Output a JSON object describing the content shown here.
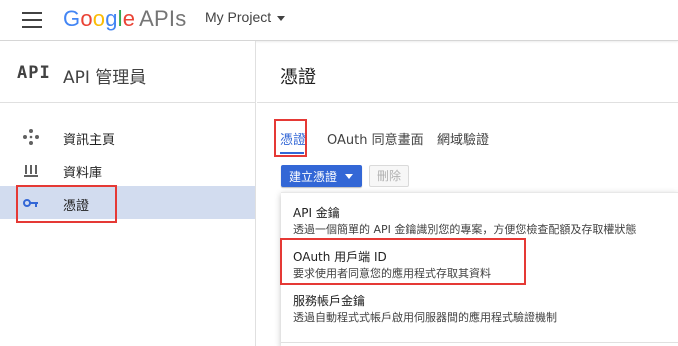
{
  "topbar": {
    "logo_letters": [
      "G",
      "o",
      "o",
      "g",
      "l",
      "e"
    ],
    "logo_suffix": "APIs",
    "project_name": "My Project"
  },
  "sidebar": {
    "api_mark": "API",
    "title": "API 管理員",
    "items": [
      {
        "icon": "diamond-dots-icon",
        "label": "資訊主頁",
        "active": false
      },
      {
        "icon": "library-icon",
        "label": "資料庫",
        "active": false
      },
      {
        "icon": "key-icon",
        "label": "憑證",
        "active": true
      }
    ]
  },
  "main": {
    "title": "憑證",
    "tabs": [
      {
        "label": "憑證",
        "active": true
      },
      {
        "label": "OAuth 同意畫面",
        "active": false
      },
      {
        "label": "網域驗證",
        "active": false
      }
    ],
    "create_label": "建立憑證",
    "delete_label": "刪除",
    "menu": [
      {
        "title": "API 金鑰",
        "desc": "透過一個簡單的 API 金鑰識別您的專案，方便您檢查配額及存取權狀態"
      },
      {
        "title": "OAuth 用戶端 ID",
        "desc": "要求使用者同意您的應用程式存取其資料"
      },
      {
        "title": "服務帳戶金鑰",
        "desc": "透過自動程式式帳戶啟用伺服器間的應用程式驗證機制"
      }
    ]
  },
  "colors": {
    "accent": "#3367d6",
    "highlight": "#e53935",
    "active_nav_bg": "#d2dcef"
  }
}
